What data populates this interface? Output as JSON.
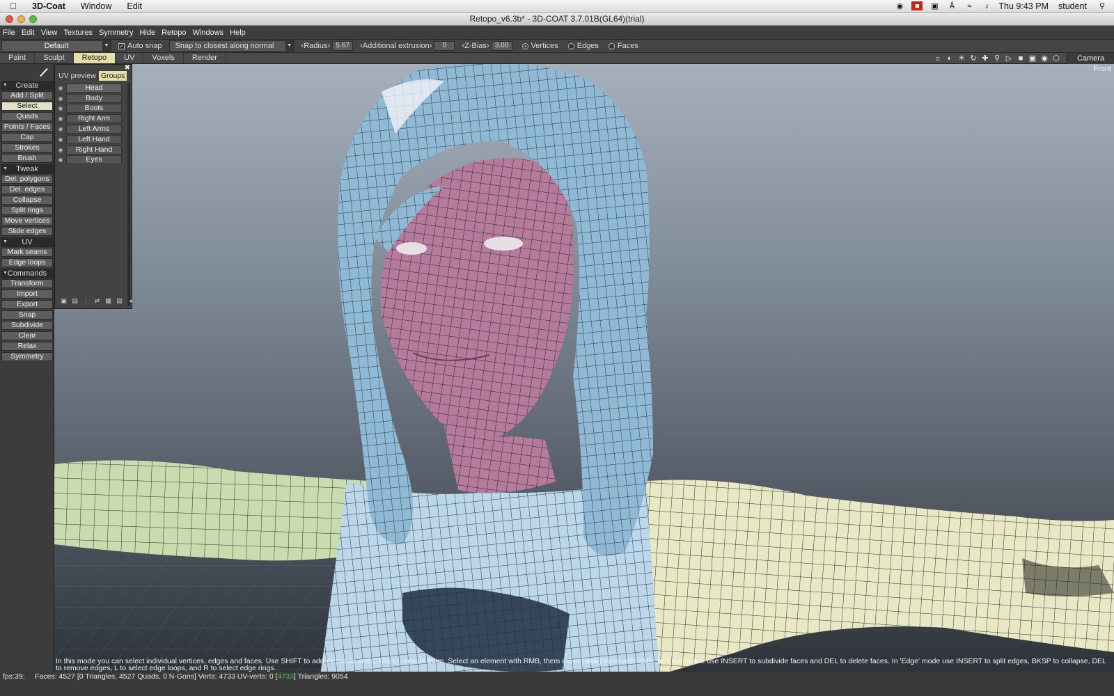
{
  "mac_menubar": {
    "app": "3D-Coat",
    "items": [
      "Window",
      "Edit"
    ],
    "clock": "Thu 9:43 PM",
    "user": "student"
  },
  "window": {
    "title": "Retopo_v6.3b* - 3D-COAT 3.7.01B(GL64)(trial)"
  },
  "menu": [
    "File",
    "Edit",
    "View",
    "Textures",
    "Symmetry",
    "Hide",
    "Retopo",
    "Windows",
    "Help"
  ],
  "toolopts": {
    "preset": "Default",
    "auto_snap": "Auto snap",
    "snap_mode": "Snap to closest along normal",
    "radius_label": "‹Radius›",
    "radius_value": "5.67",
    "extrusion_label": "‹Additional extrusion›",
    "extrusion_value": "0",
    "zbias_label": "‹Z-Bias›",
    "zbias_value": "3.00",
    "mode_vertices": "Vertices",
    "mode_edges": "Edges",
    "mode_faces": "Faces"
  },
  "rooms": [
    "Paint",
    "Sculpt",
    "Retopo",
    "UV",
    "Voxels",
    "Render"
  ],
  "active_room": "Retopo",
  "camera_label": "Camera",
  "view_label": "Front",
  "left_panel": {
    "create": "Create",
    "create_tools": [
      "Add / Split",
      "Select",
      "Quads",
      "Points / Faces",
      "Cap",
      "Strokes",
      "Brush"
    ],
    "tweak": "Tweak",
    "tweak_tools": [
      "Del. polygons",
      "Del. edges",
      "Collapse",
      "Split rings",
      "Move vertices",
      "Slide edges"
    ],
    "uv": "UV",
    "uv_tools": [
      "Mark seams",
      "Edge loops"
    ],
    "commands": "Commands",
    "command_tools": [
      "Transform",
      "Import",
      "Export",
      "Snap",
      "Subdivide",
      "Clear",
      "Relax",
      "Symmetry"
    ]
  },
  "groups_panel": {
    "tab_uv": "UV preview",
    "tab_groups": "Groups",
    "groups": [
      "Head",
      "Body",
      "Boots",
      "Right Arm",
      "Left Arms",
      "Left Hand",
      "Right Hand",
      "Eyes"
    ]
  },
  "help_text": "In this mode you can select individual vertices, edges and faces.  Use SHIFT to add elements and CTRL to remove them. Select an element with RMB, them move (slide) them with RMB. In 'Face' mode use INSERT to subdivide faces and DEL to delete faces. In 'Edge' mode use INSERT to split edges, BKSP to collapse, DEL to remove edges, L to select edge loops, and R to select edge rings.",
  "status": {
    "fps": "fps:39;",
    "faces": "Faces: 4527 [0 Triangles, 4527 Quads, 0 N-Gons] Verts: 4733  UV-verts: 0 [",
    "uv_count": "4733",
    "triangles": "] Triangles: 9054"
  },
  "colors": {
    "active_tab": "#e6dfa9",
    "active_tool": "#e3e1c4",
    "skin_mesh": "#b57a9c",
    "hair_mesh": "#8fb9d4",
    "shirt_mesh": "#bcd6ea",
    "arm_left_mesh": "#c9dcae",
    "arm_right_mesh": "#e8e8c4"
  }
}
